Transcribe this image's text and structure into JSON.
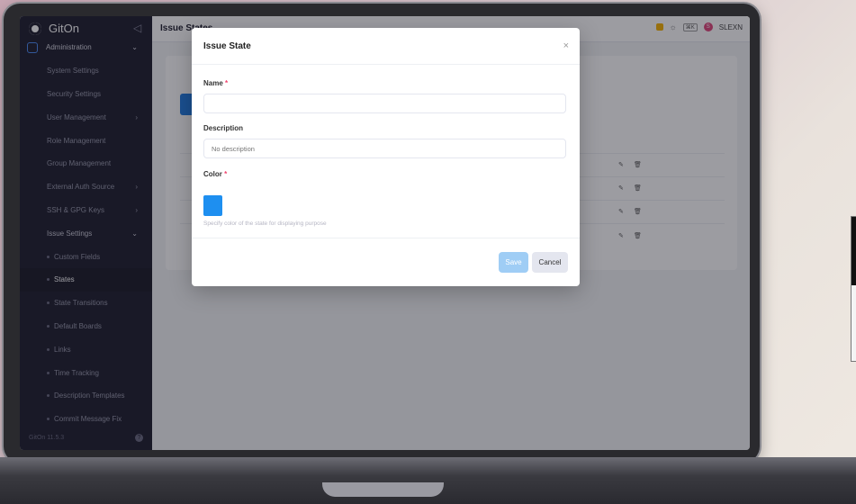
{
  "app": {
    "name": "GitOn",
    "version": "GitOn 11.5.3"
  },
  "sidebar": {
    "items": [
      {
        "label": "Administration",
        "kind": "section"
      },
      {
        "label": "System Settings"
      },
      {
        "label": "Security Settings"
      },
      {
        "label": "User Management",
        "chevron": "›"
      },
      {
        "label": "Role Management"
      },
      {
        "label": "Group Management"
      },
      {
        "label": "External Auth Source",
        "chevron": "›"
      },
      {
        "label": "SSH & GPG Keys",
        "chevron": "›"
      },
      {
        "label": "Issue Settings",
        "chevron": "⌄"
      },
      {
        "label": "Custom Fields"
      },
      {
        "label": "States",
        "active": true
      },
      {
        "label": "State Transitions"
      },
      {
        "label": "Default Boards"
      },
      {
        "label": "Links"
      },
      {
        "label": "Time Tracking"
      },
      {
        "label": "Description Templates"
      },
      {
        "label": "Commit Message Fix"
      }
    ]
  },
  "topbar": {
    "title": "Issue States",
    "kbd": "⌘K",
    "user": "SLEXN",
    "avatar_letter": "S"
  },
  "modal": {
    "title": "Issue State",
    "close": "×",
    "name_label": "Name",
    "required_mark": "*",
    "description_label": "Description",
    "description_placeholder": "No description",
    "color_label": "Color",
    "color_value": "#1e8ff0",
    "color_hint": "Specify color of the state for displaying purpose",
    "save_label": "Save",
    "cancel_label": "Cancel"
  },
  "row_icons": {
    "edit": "✎",
    "delete": "🗑"
  }
}
